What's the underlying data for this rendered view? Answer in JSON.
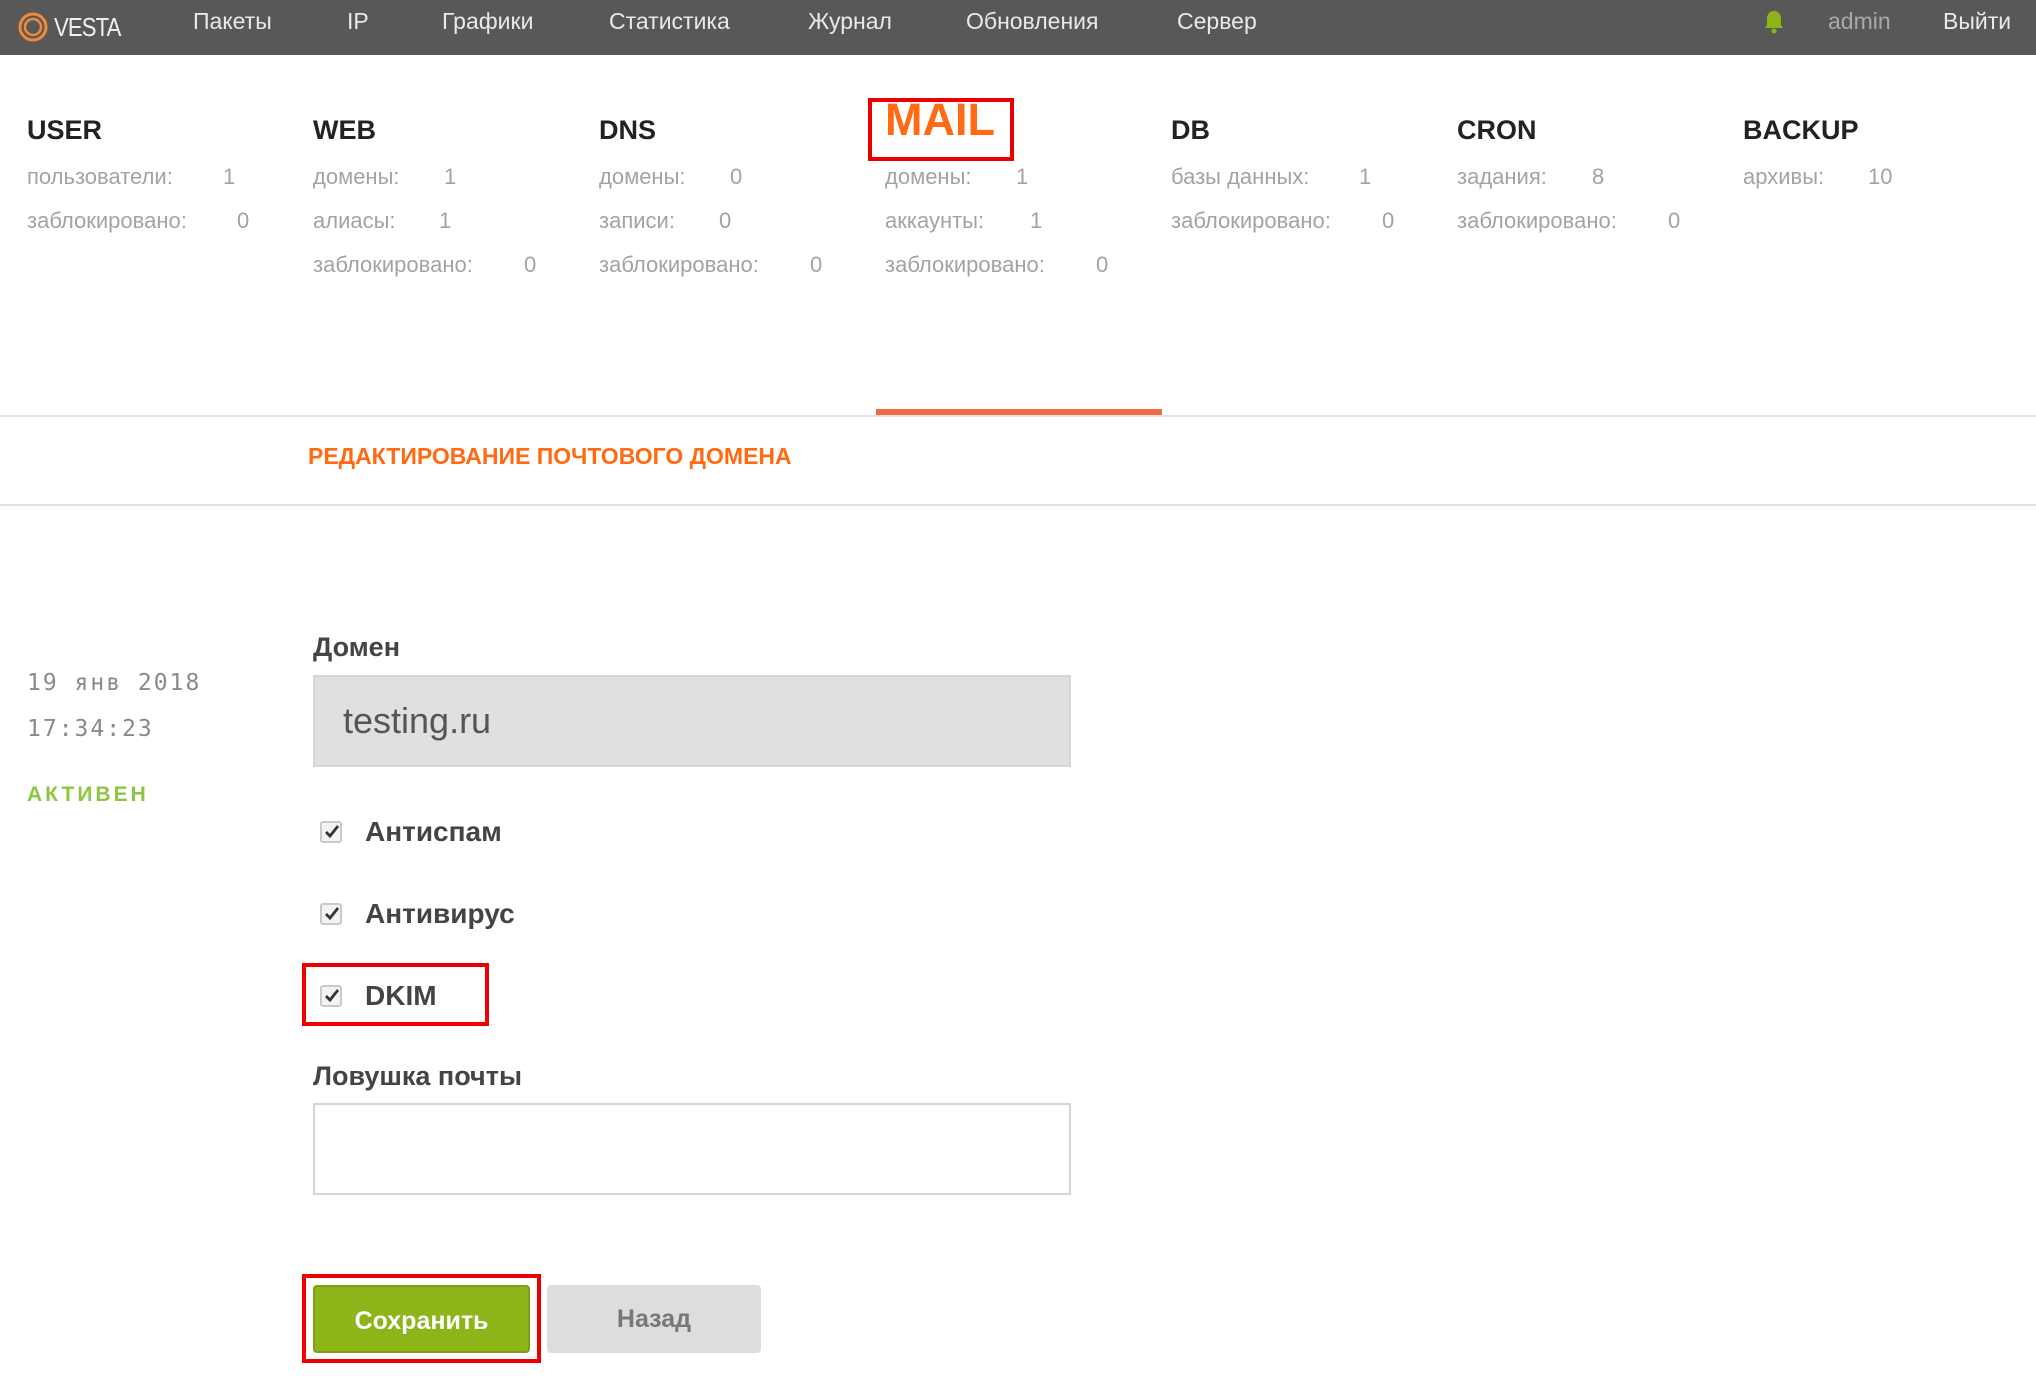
{
  "topbar": {
    "logo": "VESTA",
    "nav": [
      "Пакеты",
      "IP",
      "Графики",
      "Статистика",
      "Журнал",
      "Обновления",
      "Сервер"
    ],
    "user": "admin",
    "logout": "Выйти"
  },
  "stats": [
    {
      "title": "USER",
      "rows": [
        {
          "label": "пользователи:",
          "value": "1"
        },
        {
          "label": "заблокировано:",
          "value": "0"
        }
      ]
    },
    {
      "title": "WEB",
      "rows": [
        {
          "label": "домены:",
          "value": "1"
        },
        {
          "label": "алиасы:",
          "value": "1"
        },
        {
          "label": "заблокировано:",
          "value": "0"
        }
      ]
    },
    {
      "title": "DNS",
      "rows": [
        {
          "label": "домены:",
          "value": "0"
        },
        {
          "label": "записи:",
          "value": "0"
        },
        {
          "label": "заблокировано:",
          "value": "0"
        }
      ]
    },
    {
      "title": "MAIL",
      "rows": [
        {
          "label": "домены:",
          "value": "1"
        },
        {
          "label": "аккаунты:",
          "value": "1"
        },
        {
          "label": "заблокировано:",
          "value": "0"
        }
      ]
    },
    {
      "title": "DB",
      "rows": [
        {
          "label": "базы данных:",
          "value": "1"
        },
        {
          "label": "заблокировано:",
          "value": "0"
        }
      ]
    },
    {
      "title": "CRON",
      "rows": [
        {
          "label": "задания:",
          "value": "8"
        },
        {
          "label": "заблокировано:",
          "value": "0"
        }
      ]
    },
    {
      "title": "BACKUP",
      "rows": [
        {
          "label": "архивы:",
          "value": "10"
        }
      ]
    }
  ],
  "edit_title": "РЕДАКТИРОВАНИЕ ПОЧТОВОГО ДОМЕНА",
  "meta": {
    "date": "19 янв 2018",
    "time": "17:34:23",
    "status": "АКТИВЕН"
  },
  "form": {
    "domain_label": "Домен",
    "domain_value": "testing.ru",
    "antispam": "Антиспам",
    "antivirus": "Антивирус",
    "dkim": "DKIM",
    "catchall_label": "Ловушка почты",
    "catchall_value": ""
  },
  "buttons": {
    "save": "Сохранить",
    "back": "Назад"
  },
  "colors": {
    "accent": "#ff6a13",
    "topbar": "#585858",
    "save": "#8db51a",
    "status": "#8dc63f",
    "highlight": "#e00000"
  }
}
